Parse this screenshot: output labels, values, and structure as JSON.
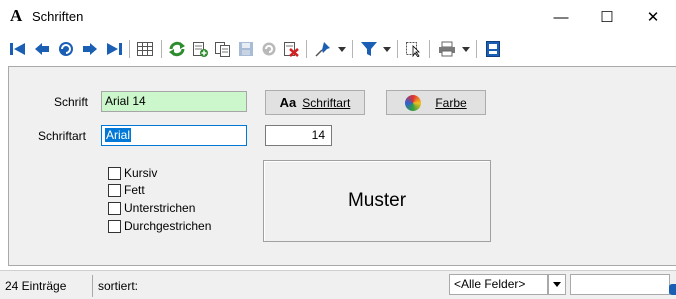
{
  "window": {
    "icon_glyph": "A",
    "title": "Schriften",
    "controls": {
      "minimize": "—",
      "maximize": "☐",
      "close": "✕"
    }
  },
  "toolbar": {
    "icons": [
      "first-record-icon",
      "prev-record-icon",
      "refresh-circle-icon",
      "next-record-icon",
      "last-record-icon",
      "table-view-icon",
      "reload-icon",
      "new-record-icon",
      "copy-record-icon",
      "save-icon",
      "undo-icon",
      "delete-record-icon",
      "pin-icon",
      "filter-icon",
      "select-cursor-icon",
      "print-icon",
      "close-form-icon"
    ]
  },
  "form": {
    "schrift_label": "Schrift",
    "schrift_value": "Arial 14",
    "schriftart_label": "Schriftart",
    "schriftart_value": "Arial",
    "size_value": "14",
    "schriftart_button": {
      "icon_text": "Aa",
      "label": "Schriftart"
    },
    "farbe_button": {
      "label": "Farbe"
    },
    "checkboxes": [
      {
        "label": "Kursiv",
        "checked": false
      },
      {
        "label": "Fett",
        "checked": false
      },
      {
        "label": "Unterstrichen",
        "checked": false
      },
      {
        "label": "Durchgestrichen",
        "checked": false
      }
    ],
    "preview_text": "Muster"
  },
  "statusbar": {
    "count": "24 Einträge",
    "sort": "sortiert:",
    "field_select": "<Alle Felder>",
    "search_value": ""
  },
  "colors": {
    "accent_blue": "#1a5fb4",
    "green_field": "#ccf7cc",
    "selection": "#0078d7"
  }
}
